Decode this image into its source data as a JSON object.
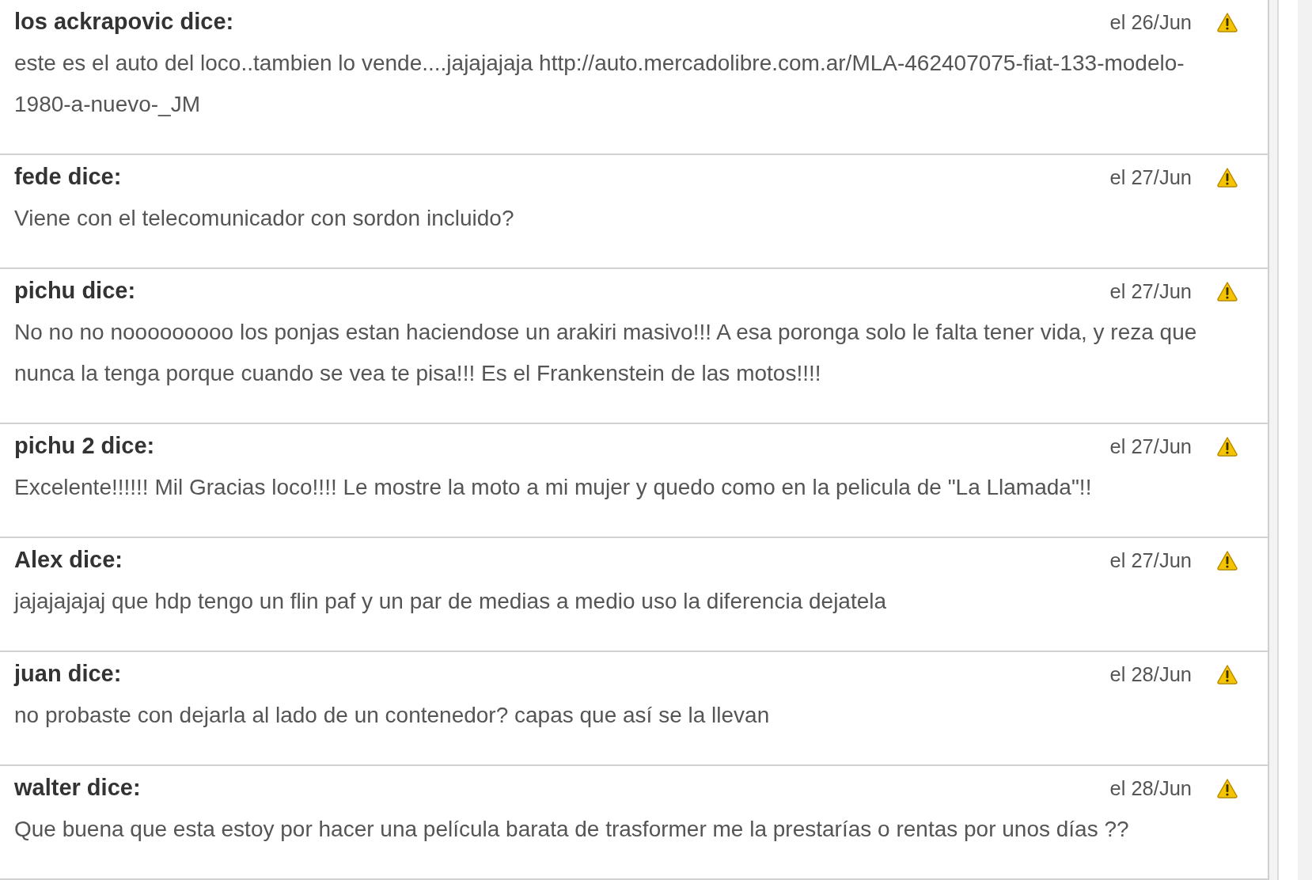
{
  "comments": [
    {
      "author": "los ackrapovic dice:",
      "date": "el 26/Jun",
      "text": "este es el auto del loco..tambien lo vende....jajajajaja http://auto.mercadolibre.com.ar/MLA-462407075-fiat-133-modelo-1980-a-nuevo-_JM"
    },
    {
      "author": "fede dice:",
      "date": "el 27/Jun",
      "text": "Viene con el telecomunicador con sordon incluido?"
    },
    {
      "author": "pichu dice:",
      "date": "el 27/Jun",
      "text": "No no no nooooooooo los ponjas estan haciendose un arakiri masivo!!! A esa poronga solo le falta tener vida, y reza que nunca la tenga porque cuando se vea te pisa!!! Es el Frankenstein de las motos!!!!"
    },
    {
      "author": "pichu 2 dice:",
      "date": "el 27/Jun",
      "text": "Excelente!!!!!! Mil Gracias loco!!!! Le mostre la moto a mi mujer y quedo como en la pelicula de \"La Llamada\"!!"
    },
    {
      "author": "Alex dice:",
      "date": "el 27/Jun",
      "text": "jajajajajaj que hdp tengo un flin paf y un par de medias a medio uso la diferencia dejatela"
    },
    {
      "author": "juan dice:",
      "date": "el 28/Jun",
      "text": "no probaste con dejarla al lado de un contenedor? capas que así se la llevan"
    },
    {
      "author": "walter dice:",
      "date": "el 28/Jun",
      "text": "Que buena que esta estoy por hacer una película barata de trasformer me la prestarías o rentas por unos días ??"
    }
  ]
}
